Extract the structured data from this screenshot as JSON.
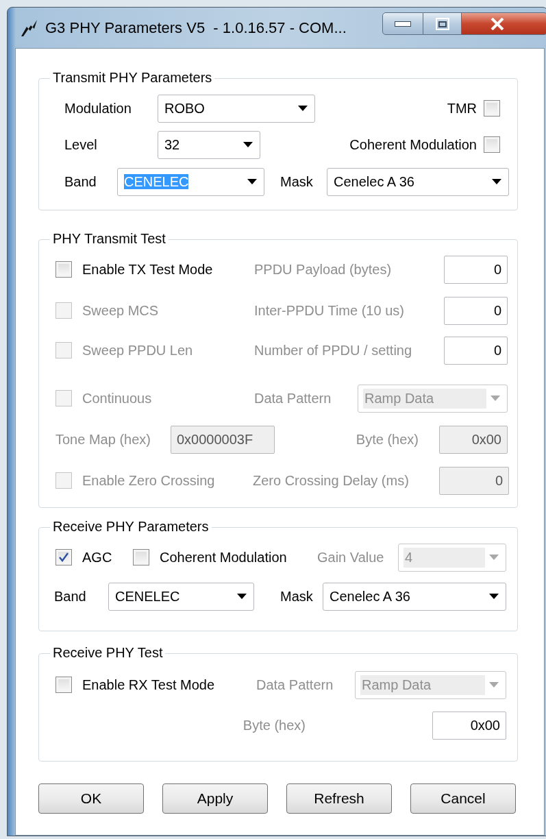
{
  "window": {
    "title": "G3 PHY Parameters V5  - 1.0.16.57 - COM..."
  },
  "sections": [
    {
      "title": "Transmit PHY Parameters",
      "controls": [
        {
          "kind": "label",
          "text": "Modulation",
          "disabled": false
        },
        {
          "kind": "combo",
          "value": "ROBO",
          "disabled": false,
          "highlighted": false
        },
        {
          "kind": "label",
          "text": "TMR",
          "disabled": false
        },
        {
          "kind": "checkbox",
          "checked": false,
          "disabled": false
        },
        {
          "kind": "label",
          "text": "Level",
          "disabled": false
        },
        {
          "kind": "combo",
          "value": "32",
          "disabled": false,
          "highlighted": false
        },
        {
          "kind": "label",
          "text": "Coherent Modulation",
          "disabled": false
        },
        {
          "kind": "checkbox",
          "checked": false,
          "disabled": false
        },
        {
          "kind": "label",
          "text": "Band",
          "disabled": false
        },
        {
          "kind": "combo",
          "value": "CENELEC",
          "disabled": false,
          "highlighted": true
        },
        {
          "kind": "label",
          "text": "Mask",
          "disabled": false
        },
        {
          "kind": "combo",
          "value": "Cenelec A 36",
          "disabled": false,
          "highlighted": false
        }
      ]
    },
    {
      "title": "PHY Transmit Test",
      "controls": [
        {
          "kind": "checkbox",
          "label": "Enable TX Test Mode",
          "checked": false,
          "disabled": false
        },
        {
          "kind": "label",
          "text": "PPDU Payload (bytes)",
          "disabled": true
        },
        {
          "kind": "textbox",
          "value": "0",
          "disabled": false
        },
        {
          "kind": "checkbox",
          "label": "Sweep MCS",
          "checked": false,
          "disabled": true
        },
        {
          "kind": "label",
          "text": "Inter-PPDU Time (10 us)",
          "disabled": true
        },
        {
          "kind": "textbox",
          "value": "0",
          "disabled": false
        },
        {
          "kind": "checkbox",
          "label": "Sweep PPDU Len",
          "checked": false,
          "disabled": true
        },
        {
          "kind": "label",
          "text": "Number of PPDU / setting",
          "disabled": true
        },
        {
          "kind": "textbox",
          "value": "0",
          "disabled": false
        },
        {
          "kind": "checkbox",
          "label": "Continuous",
          "checked": false,
          "disabled": true
        },
        {
          "kind": "label",
          "text": "Data Pattern",
          "disabled": true
        },
        {
          "kind": "combo",
          "value": "Ramp Data",
          "disabled": true,
          "highlighted": false
        },
        {
          "kind": "label",
          "text": "Tone Map (hex)",
          "disabled": true
        },
        {
          "kind": "textbox",
          "value": "0x0000003F",
          "disabled": true
        },
        {
          "kind": "label",
          "text": "Byte (hex)",
          "disabled": true
        },
        {
          "kind": "textbox",
          "value": "0x00",
          "disabled": true
        },
        {
          "kind": "checkbox",
          "label": "Enable Zero Crossing",
          "checked": false,
          "disabled": true
        },
        {
          "kind": "label",
          "text": "Zero Crossing Delay (ms)",
          "disabled": true
        },
        {
          "kind": "textbox",
          "value": "0",
          "disabled": true
        }
      ]
    },
    {
      "title": "Receive PHY Parameters",
      "controls": [
        {
          "kind": "checkbox",
          "label": "AGC",
          "checked": true,
          "disabled": false
        },
        {
          "kind": "checkbox",
          "label": "Coherent Modulation",
          "checked": false,
          "disabled": false
        },
        {
          "kind": "label",
          "text": "Gain Value",
          "disabled": true
        },
        {
          "kind": "combo",
          "value": "4",
          "disabled": true,
          "highlighted": false
        },
        {
          "kind": "label",
          "text": "Band",
          "disabled": false
        },
        {
          "kind": "combo",
          "value": "CENELEC",
          "disabled": false,
          "highlighted": false
        },
        {
          "kind": "label",
          "text": "Mask",
          "disabled": false
        },
        {
          "kind": "combo",
          "value": "Cenelec A 36",
          "disabled": false,
          "highlighted": false
        }
      ]
    },
    {
      "title": "Receive PHY Test",
      "controls": [
        {
          "kind": "checkbox",
          "label": "Enable RX Test Mode",
          "checked": false,
          "disabled": false
        },
        {
          "kind": "label",
          "text": "Data Pattern",
          "disabled": true
        },
        {
          "kind": "combo",
          "value": "Ramp Data",
          "disabled": true,
          "highlighted": false
        },
        {
          "kind": "label",
          "text": "Byte (hex)",
          "disabled": true
        },
        {
          "kind": "textbox",
          "value": "0x00",
          "disabled": false
        }
      ]
    }
  ],
  "buttons": [
    "OK",
    "Apply",
    "Refresh",
    "Cancel"
  ]
}
